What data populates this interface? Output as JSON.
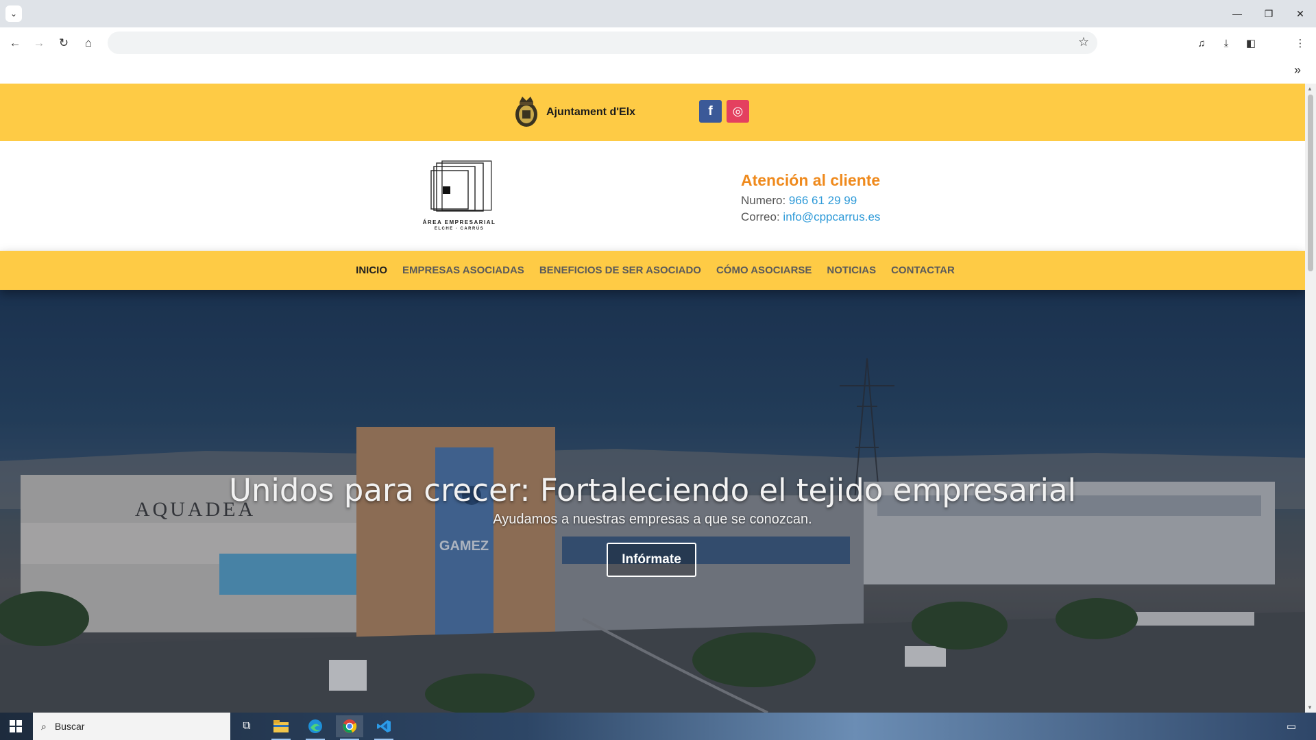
{
  "browser": {
    "address": "",
    "icons": [
      "tab-search-icon",
      "minimize-icon",
      "restore-icon",
      "close-icon",
      "back-icon",
      "forward-icon",
      "reload-icon",
      "home-icon",
      "bookmark-star-icon",
      "media-control-icon",
      "download-icon",
      "side-panel-icon",
      "menu-icon",
      "bookmarks-more-icon"
    ]
  },
  "topbar": {
    "council_name": "Ajuntament d'Elx",
    "facebook_label": "f",
    "instagram_label": "◎"
  },
  "logo": {
    "line1": "ÁREA EMPRESARIAL",
    "line2": "ELCHE · CARRÚS"
  },
  "contact": {
    "title": "Atención al cliente",
    "phone_label": "Numero:",
    "phone": "966 61 29 99",
    "email_label": "Correo:",
    "email": "info@cppcarrus.es"
  },
  "nav": {
    "items": [
      {
        "label": "INICIO"
      },
      {
        "label": "EMPRESAS ASOCIADAS"
      },
      {
        "label": "BENEFICIOS DE SER ASOCIADO"
      },
      {
        "label": "CÓMO ASOCIARSE"
      },
      {
        "label": "NOTICIAS"
      },
      {
        "label": "CONTACTAR"
      }
    ]
  },
  "hero": {
    "title": "Unidos para crecer: Fortaleciendo el tejido empresarial",
    "subtitle": "Ayudamos a nuestras empresas a que se conozcan.",
    "cta": "Infórmate",
    "signs": [
      "AQUADEA",
      "GAMEZ"
    ]
  },
  "taskbar": {
    "search_placeholder": "Buscar",
    "apps": [
      "task-view-icon",
      "file-explorer-icon",
      "edge-icon",
      "chrome-icon",
      "vscode-icon"
    ]
  },
  "colors": {
    "brand_yellow": "#fecb45",
    "accent_orange": "#ef8a1d",
    "link_blue": "#2e9ad8",
    "facebook": "#3b5998",
    "instagram": "#e4405f"
  }
}
